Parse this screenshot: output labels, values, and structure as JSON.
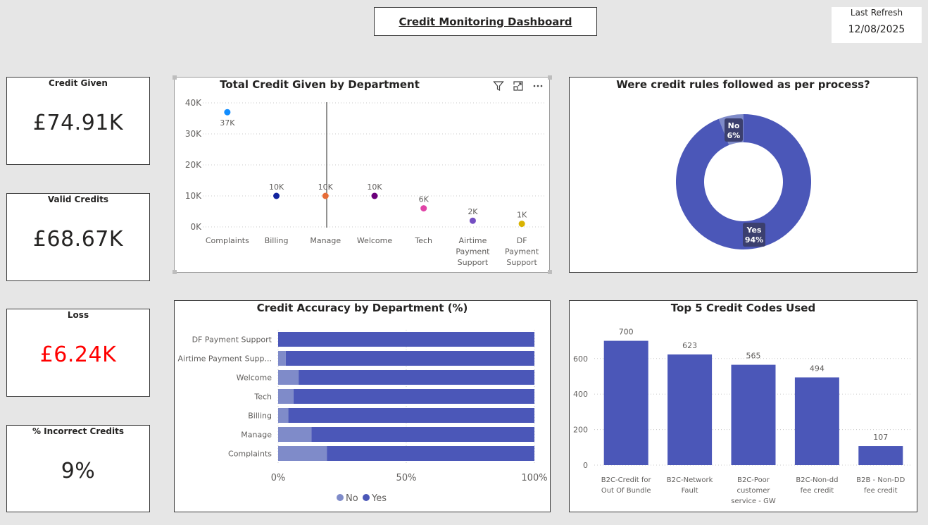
{
  "header": {
    "title": "Credit Monitoring Dashboard",
    "last_refresh_label": "Last Refresh",
    "last_refresh_value": "12/08/2025"
  },
  "kpis": [
    {
      "label": "Credit Given",
      "value": "£74.91K",
      "color": "#252423"
    },
    {
      "label": "Valid Credits",
      "value": "£68.67K",
      "color": "#252423"
    },
    {
      "label": "Loss",
      "value": "£6.24K",
      "color": "#ff0000"
    },
    {
      "label": "% Incorrect Credits",
      "value": "9%",
      "color": "#252423"
    }
  ],
  "toolbar_icons": [
    "filter-icon",
    "focus-mode-icon",
    "more-options-icon"
  ],
  "chart_data": [
    {
      "type": "scatter",
      "title": "Total Credit Given by Department",
      "categories": [
        [
          "Complaints"
        ],
        [
          "Billing"
        ],
        [
          "Manage"
        ],
        [
          "Welcome"
        ],
        [
          "Tech"
        ],
        [
          "Airtime",
          "Payment",
          "Support"
        ],
        [
          "DF",
          "Payment",
          "Support"
        ]
      ],
      "values": [
        37000,
        10000,
        10000,
        10000,
        6000,
        2000,
        1000
      ],
      "data_labels": [
        "37K",
        "10K",
        "10K",
        "10K",
        "6K",
        "2K",
        "1K"
      ],
      "colors": [
        "#118dff",
        "#12239e",
        "#e66c37",
        "#6b007b",
        "#e044a7",
        "#744ec2",
        "#d9b300"
      ],
      "yticks": [
        "0K",
        "10K",
        "20K",
        "30K",
        "40K"
      ],
      "ylim": [
        0,
        40000
      ],
      "grid": true
    },
    {
      "type": "pie",
      "title": "Were credit rules followed as per process?",
      "slices": [
        {
          "label": "Yes",
          "percent_label": "94%",
          "value": 94,
          "color": "#4b57b8"
        },
        {
          "label": "No",
          "percent_label": "6%",
          "value": 6,
          "color": "#7f8bc9"
        }
      ]
    },
    {
      "type": "bar",
      "title": "Credit Accuracy by Department (%)",
      "categories": [
        "DF Payment Support",
        "Airtime Payment Supp...",
        "Welcome",
        "Tech",
        "Billing",
        "Manage",
        "Complaints"
      ],
      "series": [
        {
          "name": "No",
          "values": [
            0,
            3,
            8,
            6,
            4,
            13,
            19
          ],
          "color": "#7f8bc9"
        },
        {
          "name": "Yes",
          "values": [
            100,
            97,
            92,
            94,
            96,
            87,
            81
          ],
          "color": "#4b57b8"
        }
      ],
      "xticks": [
        "0%",
        "50%",
        "100%"
      ],
      "xlim": [
        0,
        100
      ],
      "legend": "bottom-center"
    },
    {
      "type": "bar",
      "title": "Top 5 Credit Codes Used",
      "categories": [
        [
          "B2C-Credit for",
          "Out Of Bundle"
        ],
        [
          "B2C-Network",
          "Fault"
        ],
        [
          "B2C-Poor",
          "customer",
          "service - GW"
        ],
        [
          "B2C-Non-dd",
          "fee credit"
        ],
        [
          "B2B - Non-DD",
          "fee credit"
        ]
      ],
      "values": [
        700,
        623,
        565,
        494,
        107
      ],
      "data_labels": [
        "700",
        "623",
        "565",
        "494",
        "107"
      ],
      "yticks": [
        "0",
        "200",
        "400",
        "600"
      ],
      "ylim": [
        0,
        750
      ],
      "color": "#4b57b8",
      "grid": true
    }
  ]
}
